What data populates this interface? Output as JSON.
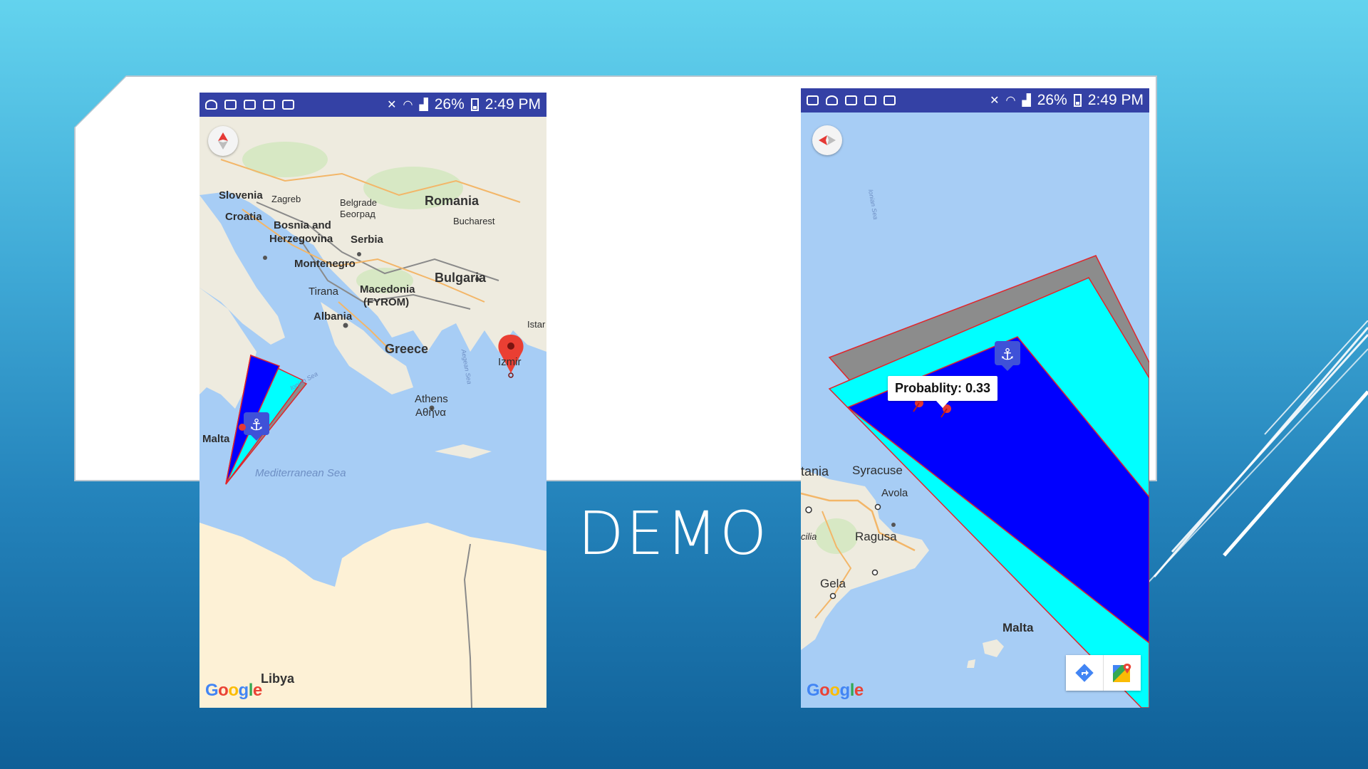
{
  "slide": {
    "title": "DEMO",
    "colors": {
      "background_top": "#63d3ee",
      "background_bottom": "#0f5f97",
      "panel": "#ffffff"
    }
  },
  "status_bar": {
    "battery": "26%",
    "time": "2:49 PM"
  },
  "left_map": {
    "labels": {
      "slovenia": "Slovenia",
      "zagreb": "Zagreb",
      "croatia": "Croatia",
      "belgrade": "Belgrade",
      "belgrade_cyr": "Београд",
      "romania": "Romania",
      "bucharest": "Bucharest",
      "bosnia": "Bosnia and",
      "herzegovina": "Herzegovina",
      "serbia": "Serbia",
      "montenegro": "Montenegro",
      "bulgaria": "Bulgaria",
      "tirana": "Tirana",
      "macedonia": "Macedonia",
      "fyrom": "(FYROM)",
      "albania": "Albania",
      "greece": "Greece",
      "izmir": "Izmir",
      "istanbul_partial": "Istar",
      "athens": "Athens",
      "athens_greek": "Αθήνα",
      "malta": "Malta",
      "libya": "Libya",
      "ionian_sea": "Ionian Sea",
      "aegean_sea": "Aegean Sea",
      "mediterranean": "Mediterranean Sea"
    },
    "attribution": [
      "G",
      "o",
      "o",
      "g",
      "l",
      "e"
    ]
  },
  "right_map": {
    "labels": {
      "catania_partial": "tania",
      "syracuse": "Syracuse",
      "avola": "Avola",
      "sicilia_partial": "cilia",
      "ragusa": "Ragusa",
      "gela": "Gela",
      "malta": "Malta",
      "ionian_sea": "Ionian Sea"
    },
    "tooltip": "Probablity: 0.33",
    "probability": 0.33,
    "attribution": [
      "G",
      "o",
      "o",
      "g",
      "l",
      "e"
    ],
    "polygon_colors": {
      "outer": "#8c8c8c",
      "middle": "#00ffff",
      "inner": "#0000ff",
      "stroke": "#e0262b"
    }
  },
  "icons": {
    "anchor": "anchor-marker-icon",
    "pin": "red-pushpin-icon",
    "location": "red-location-pin-icon",
    "compass": "compass-icon",
    "directions": "directions-icon",
    "maps_app": "google-maps-icon"
  }
}
